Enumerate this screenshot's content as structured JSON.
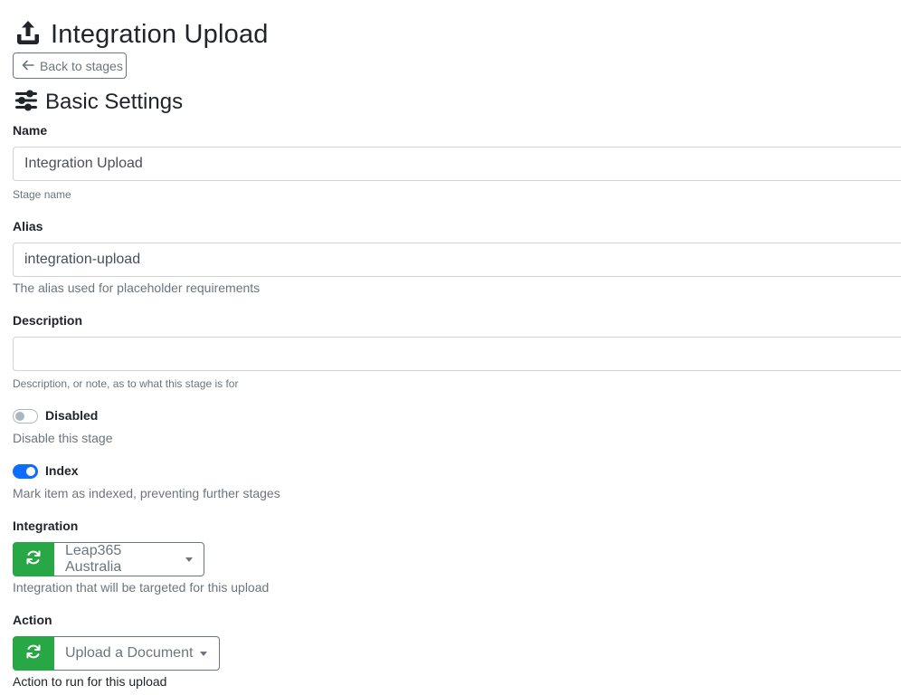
{
  "header": {
    "title": "Integration Upload",
    "icon": "upload-icon"
  },
  "back_button": {
    "label": "Back to stages",
    "icon": "arrow-left-icon"
  },
  "section": {
    "title": "Basic Settings",
    "icon": "sliders-icon"
  },
  "fields": {
    "name": {
      "label": "Name",
      "value": "Integration Upload",
      "help": "Stage name"
    },
    "alias": {
      "label": "Alias",
      "value": "integration-upload",
      "help": "The alias used for placeholder requirements"
    },
    "description": {
      "label": "Description",
      "value": "",
      "help": "Description, or note, as to what this stage is for"
    },
    "disabled": {
      "label": "Disabled",
      "checked": false,
      "help": "Disable this stage"
    },
    "index": {
      "label": "Index",
      "checked": true,
      "help": "Mark item as indexed, preventing further stages"
    },
    "integration": {
      "label": "Integration",
      "selected": "Leap365 Australia",
      "help": "Integration that will be targeted for this upload",
      "icon": "refresh-icon"
    },
    "action": {
      "label": "Action",
      "selected": "Upload a Document",
      "help": "Action to run for this upload",
      "icon": "refresh-icon"
    }
  },
  "colors": {
    "accent_green": "#28a745",
    "toggle_blue": "#0d6efd",
    "muted": "#6c757d"
  }
}
